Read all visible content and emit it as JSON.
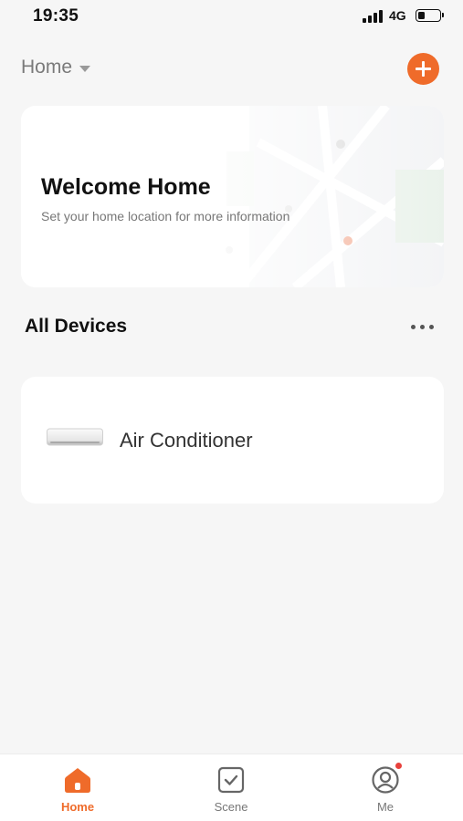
{
  "status_bar": {
    "time": "19:35",
    "network": "4G",
    "battery_level": 0.35
  },
  "header": {
    "home_label": "Home",
    "caret_icon": "caret-down-icon",
    "add_icon": "plus-icon"
  },
  "welcome_card": {
    "title": "Welcome Home",
    "subtitle": "Set your home location for more information"
  },
  "devices_section": {
    "title": "All Devices",
    "more_icon": "more-dots-icon",
    "devices": [
      {
        "name": "Air Conditioner",
        "icon": "air-conditioner-icon"
      }
    ]
  },
  "tab_bar": {
    "tabs": [
      {
        "label": "Home",
        "icon": "home-icon",
        "active": true
      },
      {
        "label": "Scene",
        "icon": "scene-check-icon",
        "active": false
      },
      {
        "label": "Me",
        "icon": "user-profile-icon",
        "active": false
      }
    ]
  },
  "colors": {
    "accent": "#ef6b2a",
    "background": "#f6f6f6",
    "card": "#ffffff",
    "badge": "#e8413c"
  }
}
